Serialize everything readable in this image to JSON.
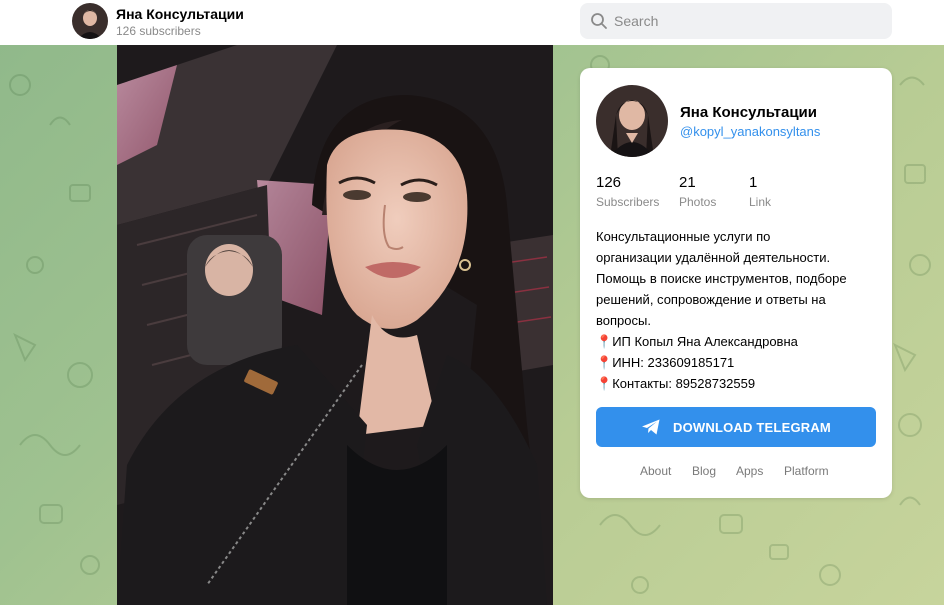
{
  "header": {
    "title": "Яна Консультации",
    "subscribers": "126 subscribers"
  },
  "search": {
    "placeholder": "Search"
  },
  "card": {
    "name": "Яна Консультации",
    "handle": "@kopyl_yanakonsyltans",
    "stats": [
      {
        "value": "126",
        "label": "Subscribers"
      },
      {
        "value": "21",
        "label": "Photos"
      },
      {
        "value": "1",
        "label": "Link"
      }
    ],
    "description": [
      "Консультационные услуги по",
      "организации удалённой деятельности.",
      "Помощь в поиске инструментов, подборе",
      "решений, сопровождение и ответы на",
      "вопросы."
    ],
    "details": [
      "ИП Копыл Яна Александровна",
      "ИНН: 233609185171",
      "Контакты: 89528732559"
    ],
    "pin_icon": "📍",
    "download_label": "DOWNLOAD TELEGRAM",
    "footer_links": [
      "About",
      "Blog",
      "Apps",
      "Platform"
    ]
  },
  "colors": {
    "accent": "#3390ec",
    "background_green": "#9fc290"
  }
}
